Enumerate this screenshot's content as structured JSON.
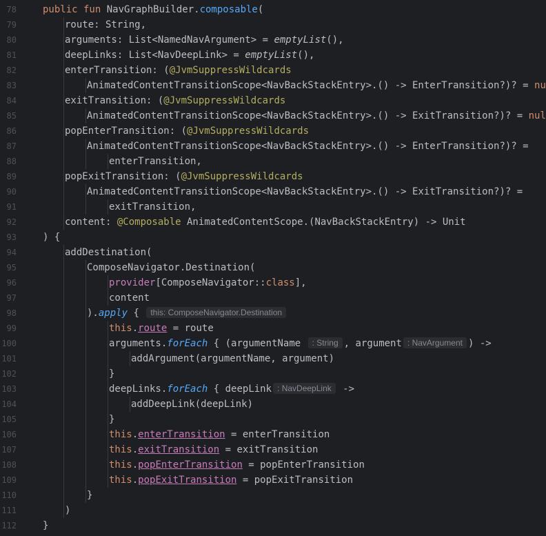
{
  "lines": [
    {
      "n": "78",
      "indent": 0,
      "tokens": [
        {
          "t": "public fun ",
          "c": "kw"
        },
        {
          "t": "NavGraphBuilder."
        },
        {
          "t": "composable",
          "c": "fn"
        },
        {
          "t": "("
        }
      ]
    },
    {
      "n": "79",
      "indent": 1,
      "tokens": [
        {
          "t": "route: String,"
        }
      ]
    },
    {
      "n": "80",
      "indent": 1,
      "tokens": [
        {
          "t": "arguments: List<NamedNavArgument> = "
        },
        {
          "t": "emptyList",
          "c": "it"
        },
        {
          "t": "(),"
        }
      ]
    },
    {
      "n": "81",
      "indent": 1,
      "tokens": [
        {
          "t": "deepLinks: List<NavDeepLink> = "
        },
        {
          "t": "emptyList",
          "c": "it"
        },
        {
          "t": "(),"
        }
      ]
    },
    {
      "n": "82",
      "indent": 1,
      "tokens": [
        {
          "t": "enterTransition: ("
        },
        {
          "t": "@JvmSuppressWildcards",
          "c": "ann"
        }
      ]
    },
    {
      "n": "83",
      "indent": 2,
      "tokens": [
        {
          "t": "AnimatedContentTransitionScope<NavBackStackEntry>.() -> EnterTransition?)? = "
        },
        {
          "t": "null",
          "c": "kw"
        },
        {
          "t": ","
        }
      ]
    },
    {
      "n": "84",
      "indent": 1,
      "tokens": [
        {
          "t": "exitTransition: ("
        },
        {
          "t": "@JvmSuppressWildcards",
          "c": "ann"
        }
      ]
    },
    {
      "n": "85",
      "indent": 2,
      "tokens": [
        {
          "t": "AnimatedContentTransitionScope<NavBackStackEntry>.() -> ExitTransition?)? = "
        },
        {
          "t": "null",
          "c": "kw"
        },
        {
          "t": ","
        }
      ]
    },
    {
      "n": "86",
      "indent": 1,
      "tokens": [
        {
          "t": "popEnterTransition: ("
        },
        {
          "t": "@JvmSuppressWildcards",
          "c": "ann"
        }
      ]
    },
    {
      "n": "87",
      "indent": 2,
      "tokens": [
        {
          "t": "AnimatedContentTransitionScope<NavBackStackEntry>.() -> EnterTransition?)? ="
        }
      ]
    },
    {
      "n": "88",
      "indent": 3,
      "tokens": [
        {
          "t": "enterTransition,"
        }
      ]
    },
    {
      "n": "89",
      "indent": 1,
      "tokens": [
        {
          "t": "popExitTransition: ("
        },
        {
          "t": "@JvmSuppressWildcards",
          "c": "ann"
        }
      ]
    },
    {
      "n": "90",
      "indent": 2,
      "tokens": [
        {
          "t": "AnimatedContentTransitionScope<NavBackStackEntry>.() -> ExitTransition?)? ="
        }
      ]
    },
    {
      "n": "91",
      "indent": 3,
      "tokens": [
        {
          "t": "exitTransition,"
        }
      ]
    },
    {
      "n": "92",
      "indent": 1,
      "tokens": [
        {
          "t": "content: "
        },
        {
          "t": "@Composable",
          "c": "ann"
        },
        {
          "t": " AnimatedContentScope.(NavBackStackEntry) -> Unit"
        }
      ]
    },
    {
      "n": "93",
      "indent": 0,
      "tokens": [
        {
          "t": ") {"
        }
      ]
    },
    {
      "n": "94",
      "indent": 1,
      "tokens": [
        {
          "t": "addDestination("
        }
      ]
    },
    {
      "n": "95",
      "indent": 2,
      "tokens": [
        {
          "t": "ComposeNavigator.Destination("
        }
      ]
    },
    {
      "n": "96",
      "indent": 3,
      "tokens": [
        {
          "t": "provider",
          "c": "prop"
        },
        {
          "t": "[ComposeNavigator::"
        },
        {
          "t": "class",
          "c": "kw"
        },
        {
          "t": "],"
        }
      ]
    },
    {
      "n": "97",
      "indent": 3,
      "tokens": [
        {
          "t": "content"
        }
      ]
    },
    {
      "n": "98",
      "indent": 2,
      "tokens": [
        {
          "t": ")."
        },
        {
          "t": "apply",
          "c": "fn it"
        },
        {
          "t": " { "
        },
        {
          "t": "this: ComposeNavigator.Destination",
          "c": "hint"
        }
      ]
    },
    {
      "n": "99",
      "indent": 3,
      "tokens": [
        {
          "t": "this",
          "c": "kw"
        },
        {
          "t": "."
        },
        {
          "t": "route",
          "c": "prop ul"
        },
        {
          "t": " = route"
        }
      ]
    },
    {
      "n": "100",
      "indent": 3,
      "tokens": [
        {
          "t": "arguments."
        },
        {
          "t": "forEach",
          "c": "fn it"
        },
        {
          "t": " { (argumentName "
        },
        {
          "t": ": String",
          "c": "hint"
        },
        {
          "t": ", argument"
        },
        {
          "t": ": NavArgument",
          "c": "hint"
        },
        {
          "t": ") ->"
        }
      ]
    },
    {
      "n": "101",
      "indent": 4,
      "tokens": [
        {
          "t": "addArgument(argumentName, argument)"
        }
      ]
    },
    {
      "n": "102",
      "indent": 3,
      "tokens": [
        {
          "t": "}"
        }
      ]
    },
    {
      "n": "103",
      "indent": 3,
      "tokens": [
        {
          "t": "deepLinks."
        },
        {
          "t": "forEach",
          "c": "fn it"
        },
        {
          "t": " { deepLink"
        },
        {
          "t": ": NavDeepLink",
          "c": "hint"
        },
        {
          "t": " ->"
        }
      ]
    },
    {
      "n": "104",
      "indent": 4,
      "tokens": [
        {
          "t": "addDeepLink(deepLink)"
        }
      ]
    },
    {
      "n": "105",
      "indent": 3,
      "tokens": [
        {
          "t": "}"
        }
      ]
    },
    {
      "n": "106",
      "indent": 3,
      "tokens": [
        {
          "t": "this",
          "c": "kw"
        },
        {
          "t": "."
        },
        {
          "t": "enterTransition",
          "c": "prop ul"
        },
        {
          "t": " = enterTransition"
        }
      ]
    },
    {
      "n": "107",
      "indent": 3,
      "tokens": [
        {
          "t": "this",
          "c": "kw"
        },
        {
          "t": "."
        },
        {
          "t": "exitTransition",
          "c": "prop ul"
        },
        {
          "t": " = exitTransition"
        }
      ]
    },
    {
      "n": "108",
      "indent": 3,
      "tokens": [
        {
          "t": "this",
          "c": "kw"
        },
        {
          "t": "."
        },
        {
          "t": "popEnterTransition",
          "c": "prop ul"
        },
        {
          "t": " = popEnterTransition"
        }
      ]
    },
    {
      "n": "109",
      "indent": 3,
      "tokens": [
        {
          "t": "this",
          "c": "kw"
        },
        {
          "t": "."
        },
        {
          "t": "popExitTransition",
          "c": "prop ul"
        },
        {
          "t": " = popExitTransition"
        }
      ]
    },
    {
      "n": "110",
      "indent": 2,
      "tokens": [
        {
          "t": "}"
        }
      ]
    },
    {
      "n": "111",
      "indent": 1,
      "tokens": [
        {
          "t": ")"
        }
      ]
    },
    {
      "n": "112",
      "indent": 0,
      "tokens": [
        {
          "t": "}"
        }
      ]
    }
  ]
}
